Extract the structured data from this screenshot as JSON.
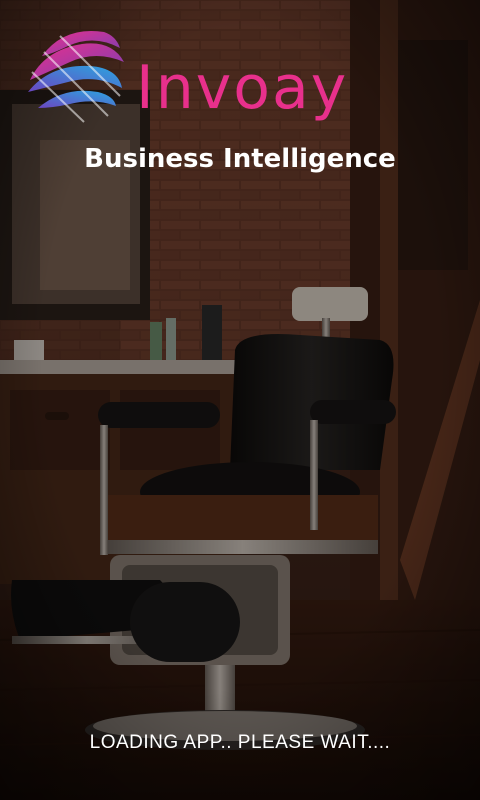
{
  "splash": {
    "brand_name": "Invoay",
    "brand_display": "Invoay",
    "tagline": "Business Intelligence",
    "loading_text": "LOADING APP.. PLEASE WAIT...."
  },
  "colors": {
    "brand_pink": "#e8308c",
    "brand_blue": "#2aa6e0",
    "text": "#ffffff"
  },
  "icons": {
    "logo": "globe-swirl-logo-icon"
  }
}
